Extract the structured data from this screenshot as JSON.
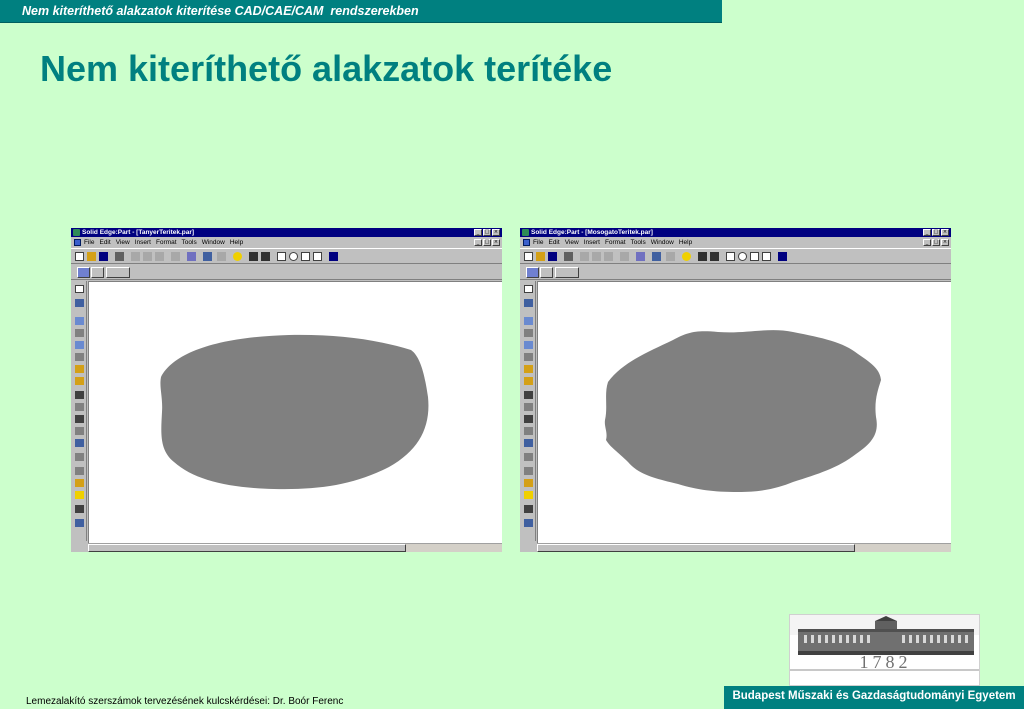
{
  "header": {
    "top_bar_text": "Nem kiteríthető alakzatok kiterítése CAD/CAE/CAM  rendszerekben",
    "title": "Nem kiteríthető alakzatok terítéke"
  },
  "windows": [
    {
      "title": "Solid Edge:Part - [TanyerTeritek.par]",
      "menus": [
        "File",
        "Edit",
        "View",
        "Insert",
        "Format",
        "Tools",
        "Window",
        "Help"
      ],
      "shape": "oval flat pattern"
    },
    {
      "title": "Solid Edge:Part - [MosogatoTeritek.par]",
      "menus": [
        "File",
        "Edit",
        "View",
        "Insert",
        "Format",
        "Tools",
        "Window",
        "Help"
      ],
      "shape": "wavy flat pattern"
    }
  ],
  "footer": {
    "left_text": "Lemezalakító szerszámok tervezésének kulcskérdései: Dr. Boór Ferenc",
    "right_text": "Budapest Műszaki és Gazdaságtudományi Egyetem",
    "logo_year": "1782"
  },
  "colors": {
    "background": "#ccffcc",
    "accent": "#008080",
    "window_chrome": "#c0c0c0",
    "titlebar": "#000080",
    "shape_fill": "#808080"
  },
  "icons": {
    "window_buttons": [
      "minimize-icon",
      "maximize-icon",
      "close-icon"
    ],
    "toolbar": [
      "new-icon",
      "open-icon",
      "save-icon",
      "print-icon",
      "cut-icon",
      "copy-icon",
      "paste-icon",
      "undo-icon",
      "zoom-icon",
      "help-icon"
    ]
  }
}
